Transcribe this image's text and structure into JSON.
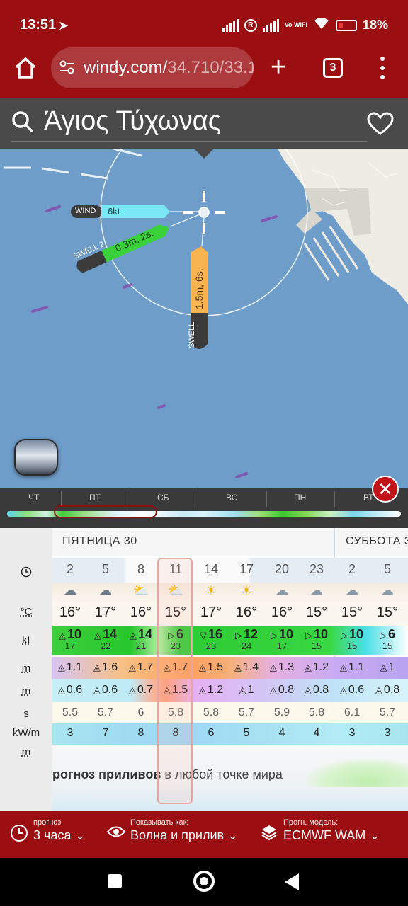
{
  "status": {
    "time": "13:51",
    "battery": "18%",
    "volte": "Vo WiFi"
  },
  "browser": {
    "url_host": "windy.com/",
    "url_path": "34.710/33.1",
    "tab_count": "3"
  },
  "search": {
    "place": "Άγιος Τύχωνας"
  },
  "map": {
    "wind_label": "WIND",
    "wind_value": "6kt",
    "swell2_label": "SWELL 2",
    "swell2_value": "0.3m, 2s.",
    "swell_label": "SWELL",
    "swell_value": "1.5m, 6s.",
    "colors": {
      "sea": "#6f9dc9",
      "wind_tag": "#7de8f5",
      "swell2_tag": "#3ad23a",
      "swell_tag": "#f7b450"
    }
  },
  "timeline": {
    "days": [
      "ЧТ",
      "ПТ",
      "СБ",
      "ВС",
      "ПН",
      "ВТ"
    ]
  },
  "forecast": {
    "units": {
      "time_icon": "clock-icon",
      "temp": "°C",
      "wind": "kt",
      "wave": "m",
      "swell": "m",
      "period": "s",
      "power": "kW/m",
      "tide": "m"
    },
    "day_headers": [
      "ПЯТНИЦА 30",
      "СУББОТА 3"
    ],
    "hours": [
      "2",
      "5",
      "8",
      "11",
      "14",
      "17",
      "20",
      "23",
      "2",
      "5"
    ],
    "icons": [
      "rain-cloud-icon",
      "rain-cloud-icon",
      "sun-rain-cloud-icon",
      "sun-rain-cloud-icon",
      "sun-icon",
      "sun-icon",
      "moon-cloud-icon",
      "moon-cloud-icon",
      "moon-cloud-icon",
      "cloud-icon"
    ],
    "temps": [
      "16°",
      "17°",
      "16°",
      "15°",
      "17°",
      "16°",
      "16°",
      "15°",
      "15°",
      "15°"
    ],
    "wind": [
      "10",
      "14",
      "14",
      "6",
      "16",
      "12",
      "10",
      "10",
      "10",
      "6"
    ],
    "gusts": [
      "17",
      "22",
      "21",
      "23",
      "23",
      "24",
      "17",
      "15",
      "15",
      "15"
    ],
    "waves": [
      "1.1",
      "1.6",
      "1.7",
      "1.7",
      "1.5",
      "1.4",
      "1.3",
      "1.2",
      "1.1",
      "1"
    ],
    "swell": [
      "0.6",
      "0.6",
      "0.7",
      "1.5",
      "1.2",
      "1",
      "0.8",
      "0.8",
      "0.6",
      "0.8"
    ],
    "period": [
      "5.5",
      "5.7",
      "6",
      "5.8",
      "5.8",
      "5.7",
      "5.9",
      "5.8",
      "6.1",
      "5.7"
    ],
    "power": [
      "3",
      "7",
      "8",
      "8",
      "6",
      "5",
      "4",
      "4",
      "3",
      "3"
    ],
    "promo_bold": "рогноз приливов",
    "promo_rest": " в любой точке мира"
  },
  "bottom": {
    "forecast_caption": "прогноз",
    "forecast_value": "3 часа",
    "show_caption": "Показывать как:",
    "show_value": "Волна и прилив",
    "model_caption": "Прогн. модель:",
    "model_value": "ECMWF WAM"
  }
}
